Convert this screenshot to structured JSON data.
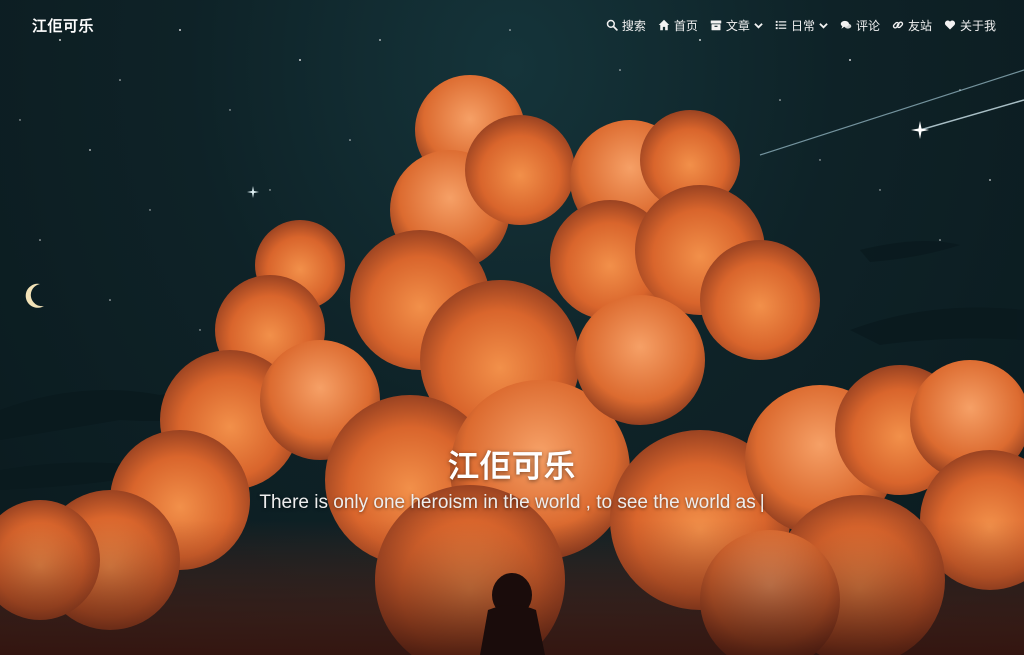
{
  "site": {
    "brand": "江佢可乐",
    "title": "江佢可乐",
    "subtitle": "There is only one heroism in the world , to see the world as",
    "cursor": "|"
  },
  "nav": {
    "search": {
      "label": "搜索",
      "icon": "search-icon"
    },
    "home": {
      "label": "首页",
      "icon": "home-icon"
    },
    "articles": {
      "label": "文章",
      "icon": "archive-box-icon"
    },
    "daily": {
      "label": "日常",
      "icon": "list-icon"
    },
    "comments": {
      "label": "评论",
      "icon": "comments-icon"
    },
    "friends": {
      "label": "友站",
      "icon": "link-icon"
    },
    "about": {
      "label": "关于我",
      "icon": "heart-icon"
    }
  },
  "colors": {
    "sky": "#0e2227",
    "cloud_light": "#f08a3c",
    "cloud_mid": "#d2622a",
    "cloud_dark": "#7a2f1c",
    "text": "#ffffff"
  }
}
